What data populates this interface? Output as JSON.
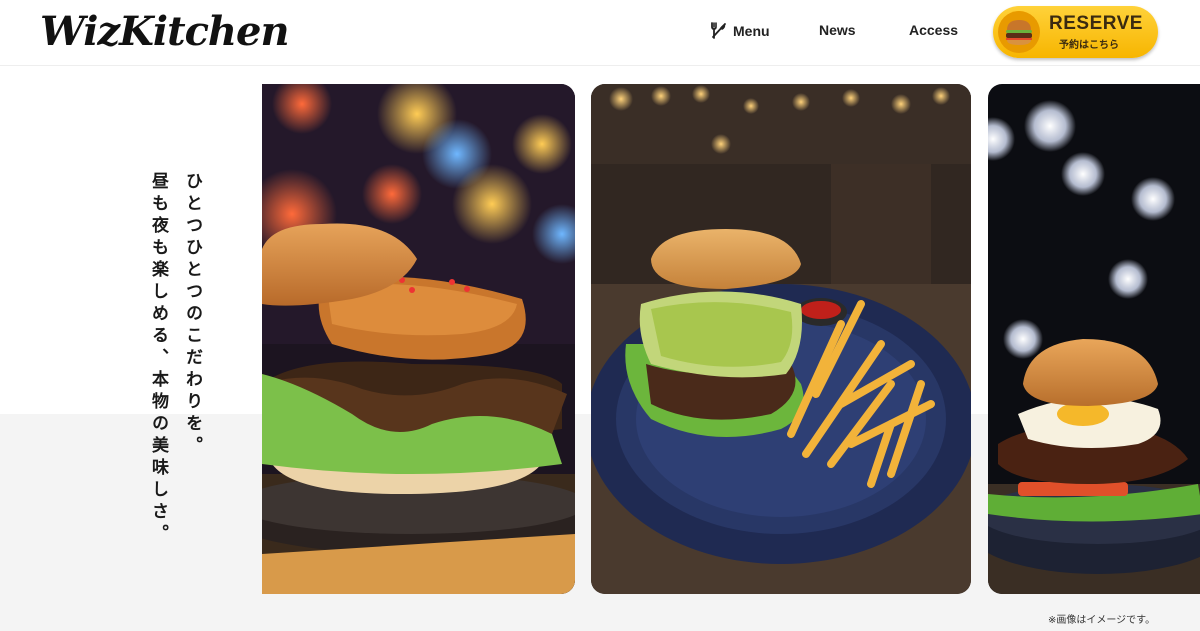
{
  "header": {
    "logo_text": "WizKitchen",
    "nav": [
      {
        "label": "Menu",
        "icon": "fork-knife-icon"
      },
      {
        "label": "News"
      },
      {
        "label": "Access"
      }
    ],
    "reserve": {
      "label": "RESERVE",
      "sub_label": "予約はこちら",
      "icon": "burger-icon",
      "color": "#f7b500"
    }
  },
  "hero": {
    "tagline_lines": [
      "ひとつひとつのこだわりを。",
      "昼も夜も楽しめる、本物の美味しさ。"
    ],
    "photos": [
      {
        "subject": "burger-with-sauce-photo"
      },
      {
        "subject": "avocado-burger-fries-photo"
      },
      {
        "subject": "egg-burger-photo"
      }
    ],
    "note": "※画像はイメージです。"
  }
}
